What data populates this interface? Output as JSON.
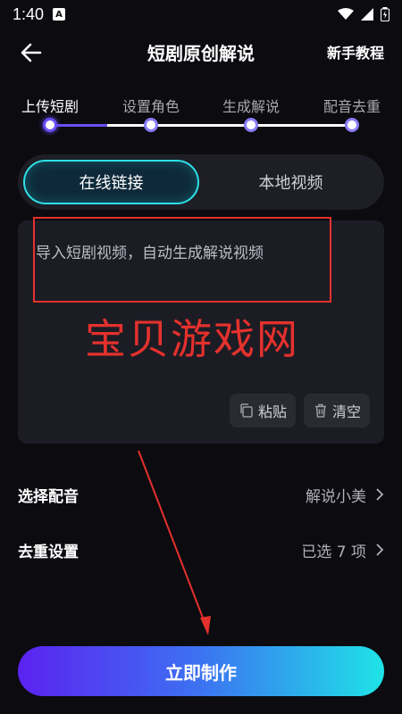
{
  "status_bar": {
    "time": "1:40",
    "notif_icon": "A"
  },
  "header": {
    "title": "短剧原创解说",
    "tutorial": "新手教程"
  },
  "steps": [
    {
      "label": "上传短剧",
      "active": true
    },
    {
      "label": "设置角色",
      "active": false
    },
    {
      "label": "生成解说",
      "active": false
    },
    {
      "label": "配音去重",
      "active": false
    }
  ],
  "tabs": {
    "online": "在线链接",
    "local": "本地视频"
  },
  "input": {
    "placeholder": "导入短剧视频，自动生成解说视频",
    "paste": "粘贴",
    "clear": "清空"
  },
  "watermark": "宝贝游戏网",
  "settings": {
    "voice_label": "选择配音",
    "voice_value": "解说小美",
    "dedup_label": "去重设置",
    "dedup_value": "已选 7 项"
  },
  "make_button": "立即制作",
  "colors": {
    "accent_cyan": "#2de0e6",
    "accent_purple": "#5b22f0",
    "annotation_red": "#e5312d"
  }
}
